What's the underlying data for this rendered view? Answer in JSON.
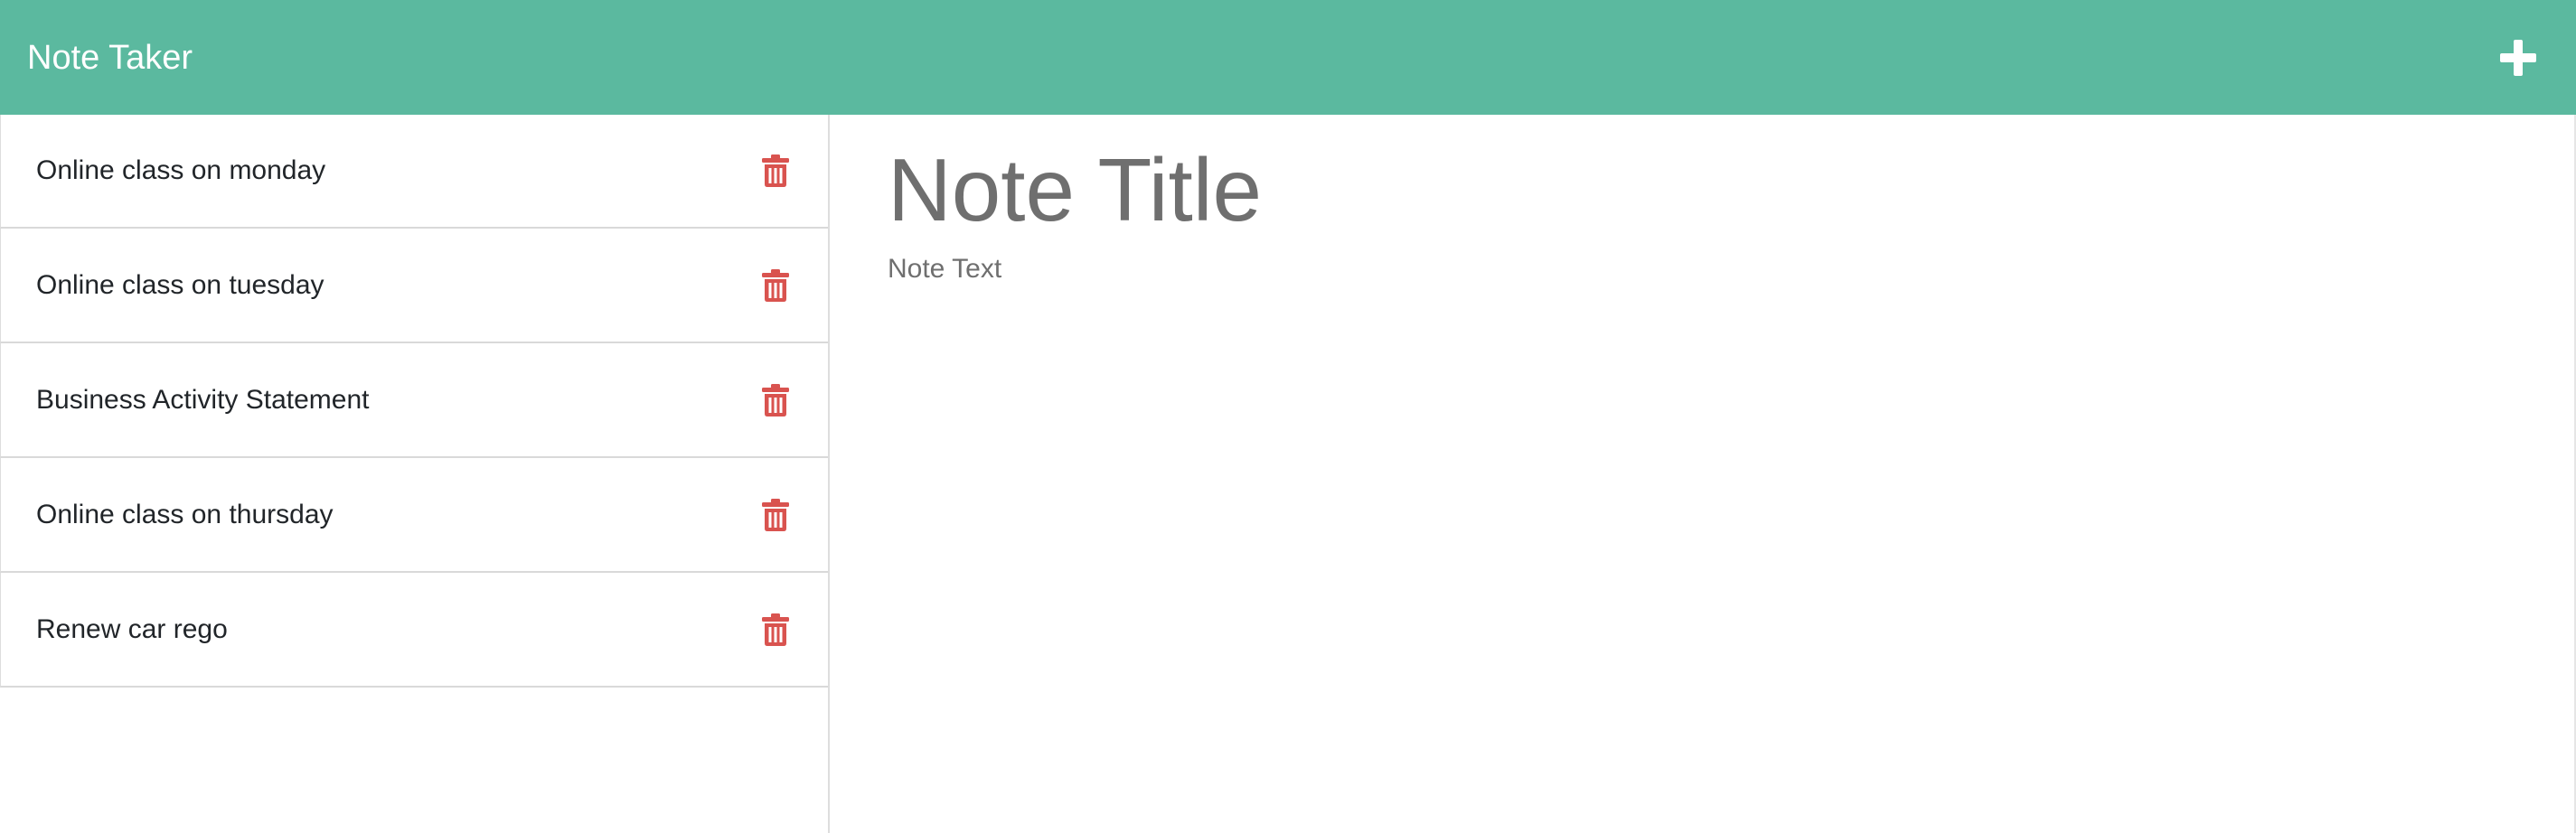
{
  "app": {
    "title": "Note Taker",
    "brand_color": "#5bb99f",
    "add_icon": "plus-icon"
  },
  "sidebar": {
    "delete_icon": "trash-icon",
    "delete_color": "#d9534f",
    "notes": [
      {
        "title": "Online class on monday"
      },
      {
        "title": "Online class on tuesday"
      },
      {
        "title": "Business Activity Statement"
      },
      {
        "title": "Online class on thursday"
      },
      {
        "title": "Renew car rego"
      }
    ]
  },
  "editor": {
    "title_placeholder": "Note Title",
    "text_placeholder": "Note Text"
  }
}
